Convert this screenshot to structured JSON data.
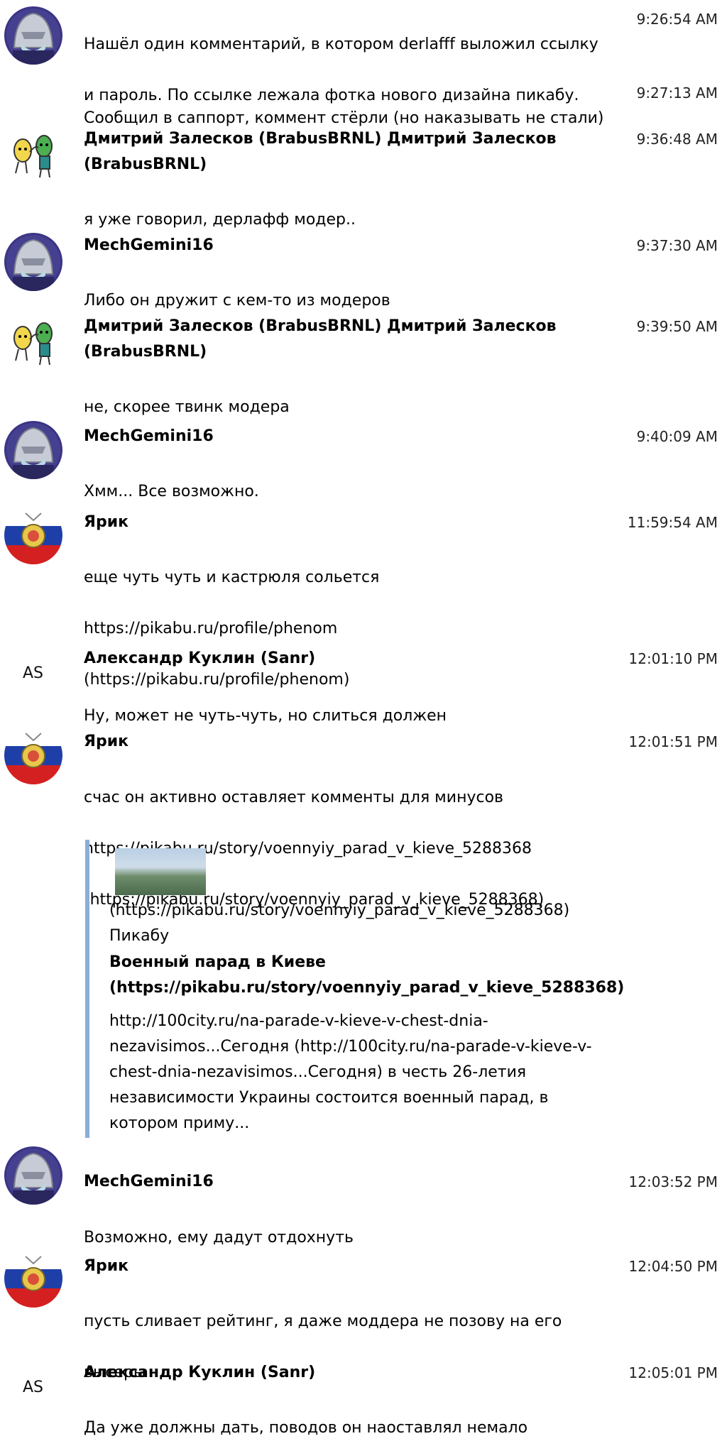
{
  "messages": [
    {
      "id": "m1",
      "avatar": "mech",
      "name": "",
      "lines": [
        "Нашёл один комментарий, в котором derlafff выложил ссылку",
        "и пароль. По ссылке лежала фотка нового дизайна пикабу."
      ],
      "time": "9:26:54 AM"
    },
    {
      "id": "m2",
      "avatar": "",
      "name": "",
      "lines": [
        "Сообщил в саппорт, коммент стёрли (но наказывать не стали)"
      ],
      "time": "9:27:13 AM"
    },
    {
      "id": "m3",
      "avatar": "dmitry",
      "name": "Дмитрий Залесков (BrabusBRNL) Дмитрий Залесков (BrabusBRNL)",
      "lines": [
        "я уже говорил, дерлафф модер.."
      ],
      "time": "9:36:48 AM"
    },
    {
      "id": "m4",
      "avatar": "mech",
      "name": "MechGemini16",
      "lines": [
        "Либо он дружит с кем-то из модеров"
      ],
      "time": "9:37:30 AM"
    },
    {
      "id": "m5",
      "avatar": "dmitry",
      "name": "Дмитрий Залесков (BrabusBRNL) Дмитрий Залесков (BrabusBRNL)",
      "lines": [
        "не, скорее твинк модера"
      ],
      "time": "9:39:50 AM"
    },
    {
      "id": "m6",
      "avatar": "mech",
      "name": "MechGemini16",
      "lines": [
        "Хмм... Все возможно."
      ],
      "time": "9:40:09 AM"
    },
    {
      "id": "m7",
      "avatar": "yarik",
      "name": "Ярик",
      "lines": [
        "еще чуть чуть и кастрюля сольется",
        "https://pikabu.ru/profile/phenom",
        "(https://pikabu.ru/profile/phenom)"
      ],
      "time": "11:59:54 AM"
    },
    {
      "id": "m8",
      "avatar": "AS",
      "name": "Александр Куклин (Sanr)",
      "lines": [
        "Ну, может не чуть-чуть, но слиться должен"
      ],
      "time": "12:01:10 PM"
    },
    {
      "id": "m9",
      "avatar": "yarik",
      "name": "Ярик",
      "lines": [
        "счас он активно оставляет комменты для минусов",
        "https://pikabu.ru/story/voennyiy_parad_v_kieve_5288368",
        "(https://pikabu.ru/story/voennyiy_parad_v_kieve_5288368)"
      ],
      "time": "12:01:51 PM"
    },
    {
      "id": "m10",
      "avatar": "mech",
      "name": "MechGemini16",
      "lines": [
        "Возможно, ему дадут отдохнуть"
      ],
      "time": "12:03:52 PM"
    },
    {
      "id": "m11",
      "avatar": "yarik",
      "name": "Ярик",
      "lines": [
        "пусть сливает рейтинг, я даже моддера не позову на его",
        "высеры"
      ],
      "time": "12:04:50 PM"
    },
    {
      "id": "m12",
      "avatar": "AS",
      "name": "Александр Куклин (Sanr)",
      "lines": [
        "Да уже должны дать, поводов он наоставлял немало"
      ],
      "time": "12:05:01 PM"
    }
  ],
  "link_preview": {
    "url_line": "(https://pikabu.ru/story/voennyiy_parad_v_kieve_5288368)",
    "site": "Пикабу",
    "title_line1": "Военный парад в Киеве",
    "title_line2": "(https://pikabu.ru/story/voennyiy_parad_v_kieve_5288368)",
    "description": "http://100city.ru/na-parade-v-kieve-v-chest-dnia-nezavisimos...Сегодня (http://100city.ru/na-parade-v-kieve-v-chest-dnia-nezavisimos...Сегодня) в честь 26-летия независимости Украины состоится военный парад, в котором приму..."
  },
  "colors": {
    "quote_border": "#8aaed6"
  }
}
